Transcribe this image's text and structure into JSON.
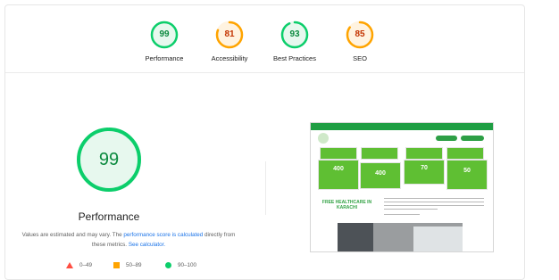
{
  "summary": {
    "gauges": [
      {
        "value": "99",
        "label": "Performance",
        "score": 0.99,
        "color": "#0cce6b",
        "text_color": "#0c8a3f",
        "bg": "#e7f8ee"
      },
      {
        "value": "81",
        "label": "Accessibility",
        "score": 0.81,
        "color": "#ffa400",
        "text_color": "#c33300",
        "bg": "#fff3e0"
      },
      {
        "value": "93",
        "label": "Best Practices",
        "score": 0.93,
        "color": "#0cce6b",
        "text_color": "#0c8a3f",
        "bg": "#e7f8ee"
      },
      {
        "value": "85",
        "label": "SEO",
        "score": 0.85,
        "color": "#ffa400",
        "text_color": "#c33300",
        "bg": "#fff3e0"
      }
    ]
  },
  "main": {
    "score": "99",
    "score_fraction": 0.99,
    "title": "Performance",
    "desc_text_1": "Values are estimated and may vary. The ",
    "desc_link_1": "performance score is calculated",
    "desc_text_2": " directly from these metrics. ",
    "desc_link_2": "See calculator.",
    "legend": [
      {
        "range": "0–49",
        "color": "#ff4e42",
        "shape": "triangle-icon"
      },
      {
        "range": "50–89",
        "color": "#ffa400",
        "shape": "square-icon"
      },
      {
        "range": "90–100",
        "color": "#0cce6b",
        "shape": "circle-icon"
      }
    ]
  },
  "screenshot": {
    "tiles": [
      "400",
      "400",
      "70",
      "50"
    ],
    "heading": "FREE HEALTHCARE IN KARACHI"
  }
}
